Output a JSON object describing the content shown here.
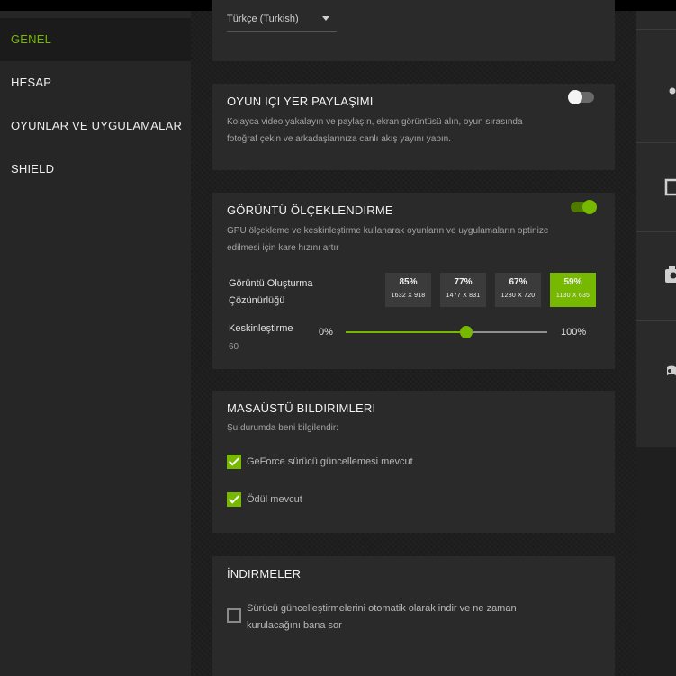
{
  "sidebar": {
    "items": [
      {
        "label": "GENEL",
        "active": true
      },
      {
        "label": "HESAP",
        "active": false
      },
      {
        "label": "OYUNLAR VE UYGULAMALAR",
        "active": false
      },
      {
        "label": "SHIELD",
        "active": false
      }
    ]
  },
  "language": {
    "value": "Türkçe (Turkish)",
    "icon": "chevron-down-icon"
  },
  "share": {
    "title": "OYUN IÇI YER PAYLAŞIMI",
    "desc": "Kolayca video yakalayın ve paylaşın, ekran görüntüsü alın, oyun sırasında fotoğraf çekin ve arkadaşlarınıza canlı akış yayını yapın.",
    "toggle_on": false
  },
  "scaling": {
    "title": "GÖRÜNTÜ ÖLÇEKLENDIRME",
    "desc": "GPU ölçekleme ve keskinleştirme kullanarak oyunların ve uygulamaların optinize edilmesi için kare hızını artır",
    "toggle_on": true,
    "render_label": "Görüntü Oluşturma Çözünürlüğü",
    "presets": [
      {
        "pct": "85%",
        "res": "1632 X 918",
        "selected": false
      },
      {
        "pct": "77%",
        "res": "1477 X 831",
        "selected": false
      },
      {
        "pct": "67%",
        "res": "1280 X 720",
        "selected": false
      },
      {
        "pct": "59%",
        "res": "1130 X 635",
        "selected": true
      }
    ],
    "sharpen_label": "Keskinleştirme",
    "sharpen_value": "60",
    "sharpen_fraction": 0.6,
    "slider_min": "0%",
    "slider_max": "100%"
  },
  "notifications": {
    "title": "MASAÜSTÜ BILDIRIMLERI",
    "subtitle": "Şu durumda beni bilgilendir:",
    "items": [
      {
        "label": "GeForce sürücü güncellemesi mevcut",
        "checked": true
      },
      {
        "label": "Ödül mevcut",
        "checked": true
      }
    ]
  },
  "downloads": {
    "title": "İNDIRMELER",
    "option_label": "Sürücü güncelleştirmelerini otomatik olarak indir ve ne zaman kurulacağını bana sor",
    "checked": false
  },
  "right_panel": {
    "icons": [
      "dot-icon",
      "display-icon",
      "camera-icon",
      "gamepad-icon"
    ]
  },
  "colors": {
    "accent": "#76b900",
    "panel": "#2a2a2a",
    "sidebar": "#262626"
  }
}
